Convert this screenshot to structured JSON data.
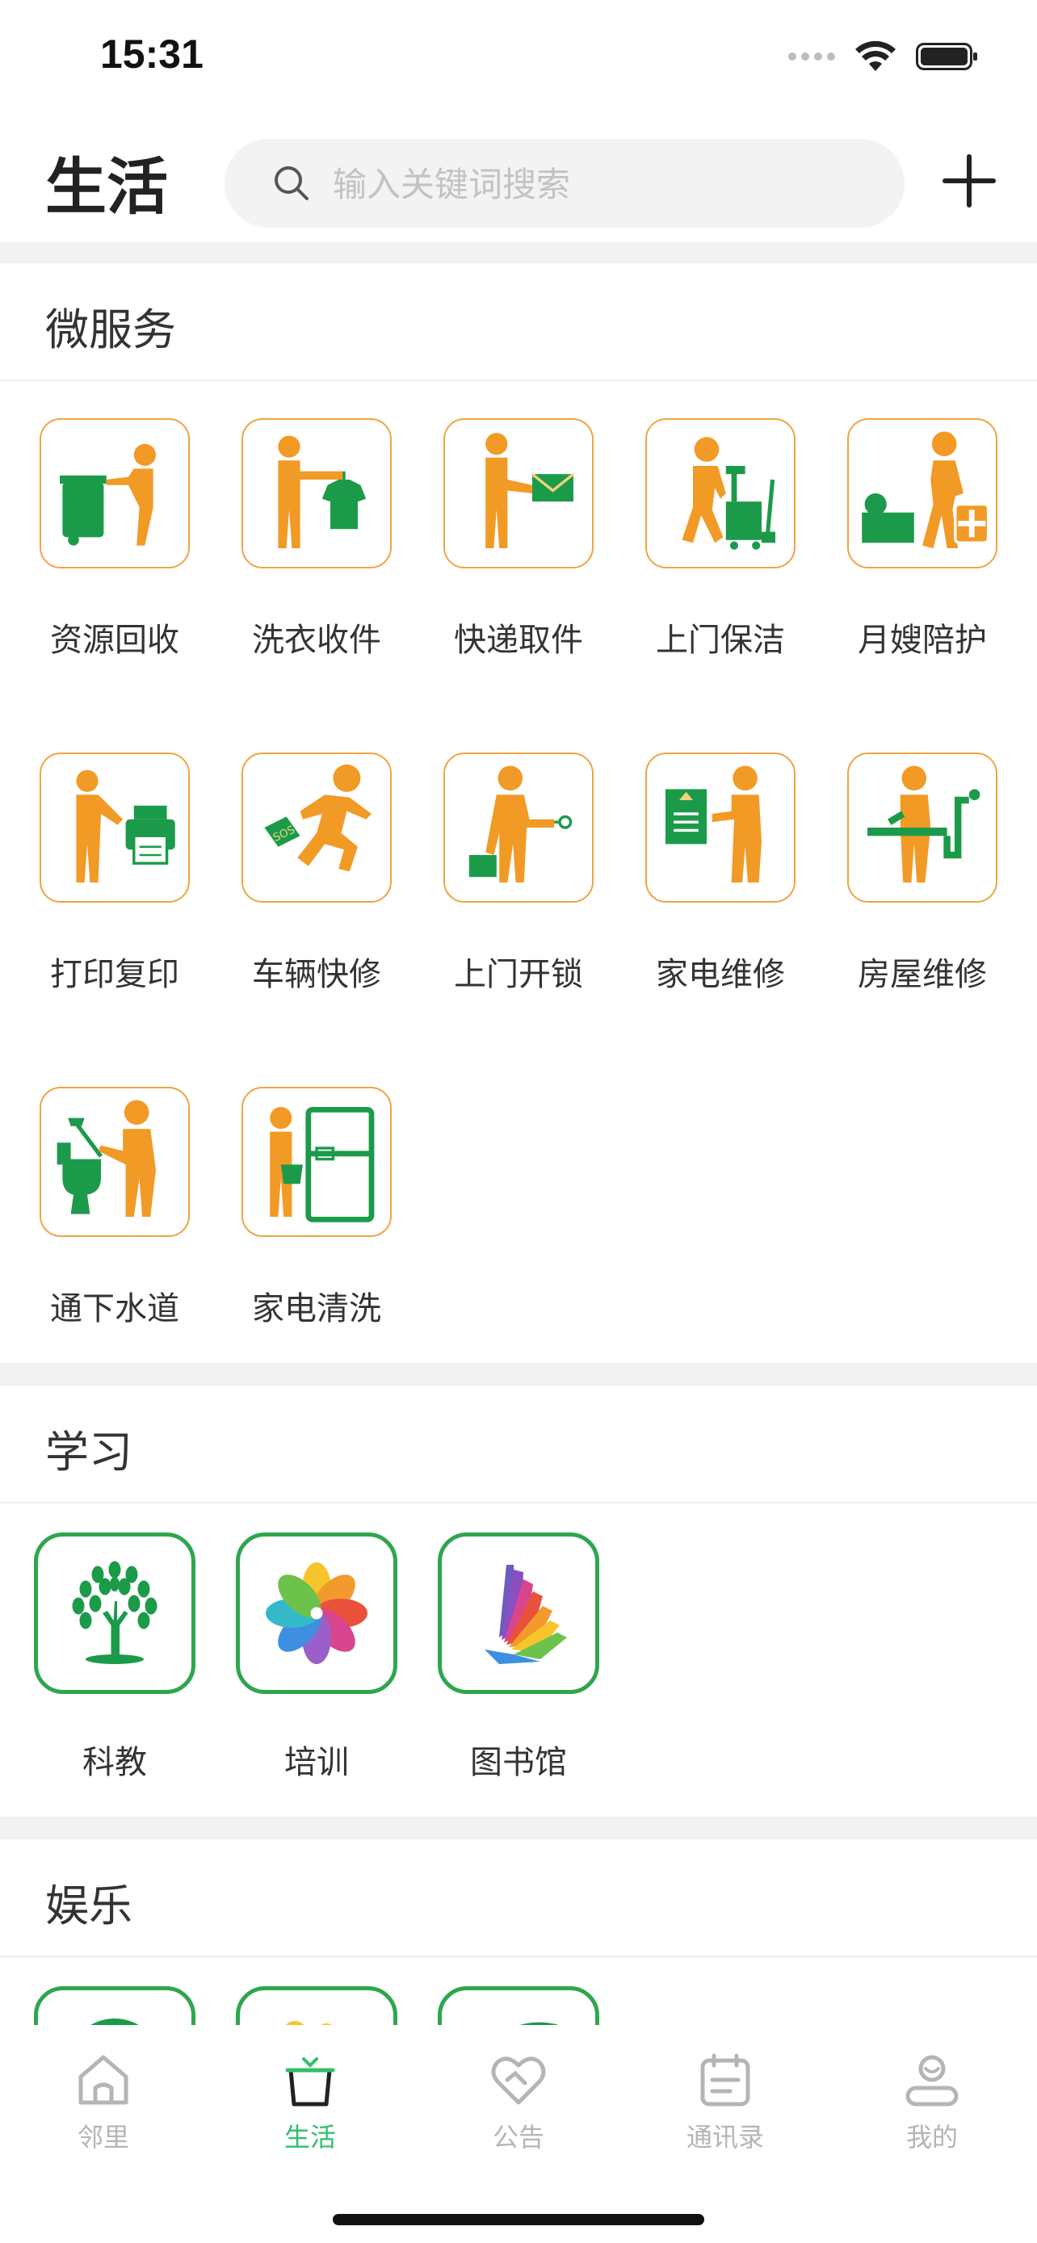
{
  "status_bar": {
    "time": "15:31"
  },
  "header": {
    "title": "生活",
    "search_placeholder": "输入关键词搜索"
  },
  "sections": {
    "micro_services": {
      "title": "微服务",
      "items": [
        {
          "label": "资源回收",
          "icon": "recycling-icon"
        },
        {
          "label": "洗衣收件",
          "icon": "laundry-icon"
        },
        {
          "label": "快递取件",
          "icon": "courier-icon"
        },
        {
          "label": "上门保洁",
          "icon": "cleaning-icon"
        },
        {
          "label": "月嫂陪护",
          "icon": "nursing-icon"
        },
        {
          "label": "打印复印",
          "icon": "printer-icon"
        },
        {
          "label": "车辆快修",
          "icon": "car-repair-icon"
        },
        {
          "label": "上门开锁",
          "icon": "unlock-icon"
        },
        {
          "label": "家电维修",
          "icon": "appliance-repair-icon"
        },
        {
          "label": "房屋维修",
          "icon": "house-repair-icon"
        },
        {
          "label": "通下水道",
          "icon": "drain-icon"
        },
        {
          "label": "家电清洗",
          "icon": "appliance-cleaning-icon"
        }
      ]
    },
    "learning": {
      "title": "学习",
      "items": [
        {
          "label": "科教",
          "icon": "tree-icon"
        },
        {
          "label": "培训",
          "icon": "pinwheel-icon"
        },
        {
          "label": "图书馆",
          "icon": "book-icon"
        }
      ]
    },
    "entertainment": {
      "title": "娱乐"
    }
  },
  "tabbar": {
    "tabs": [
      {
        "label": "邻里",
        "icon": "house-icon"
      },
      {
        "label": "生活",
        "icon": "basket-icon",
        "active": true
      },
      {
        "label": "公告",
        "icon": "heart-icon"
      },
      {
        "label": "通讯录",
        "icon": "calendar-icon"
      },
      {
        "label": "我的",
        "icon": "user-icon"
      }
    ]
  },
  "colors": {
    "accent_green": "#2fbf6a",
    "service_orange": "#f29a26",
    "service_green": "#1b9b4a",
    "tile_border_orange": "#f0a441",
    "tile_border_green": "#2fa64d"
  }
}
